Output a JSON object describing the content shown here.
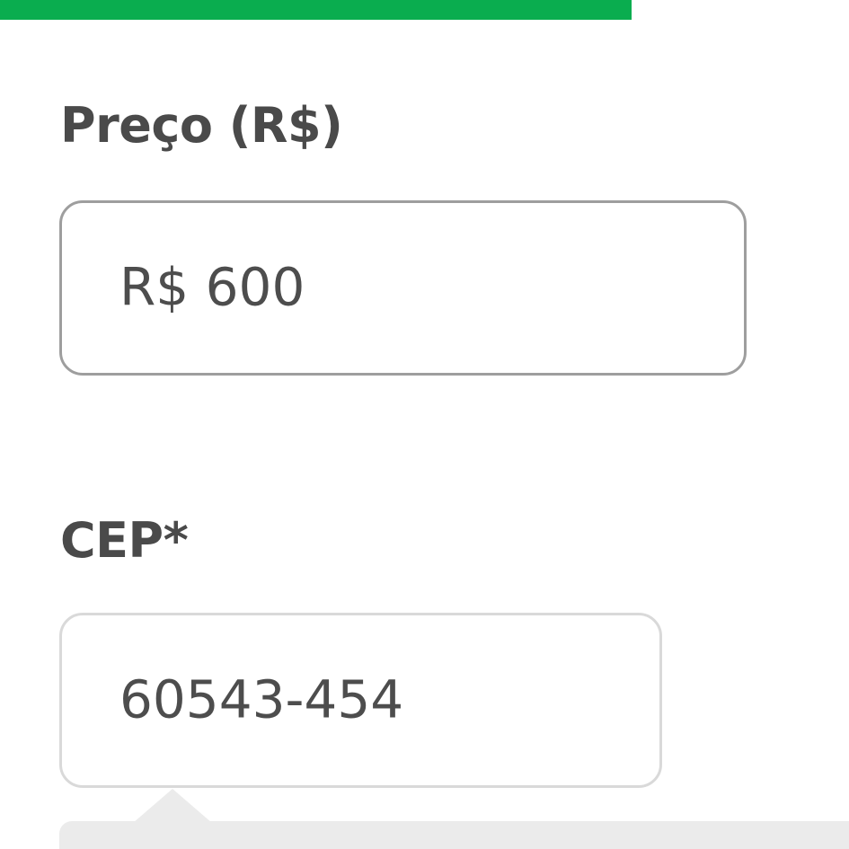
{
  "progress": {
    "fraction": 0.744,
    "color": "#0aad4f"
  },
  "form": {
    "price": {
      "label": "Preço (R$)",
      "value": "R$ 600"
    },
    "cep": {
      "label": "CEP*",
      "value": "60543-454"
    }
  },
  "tooltip": {
    "background": "#ebebeb"
  }
}
